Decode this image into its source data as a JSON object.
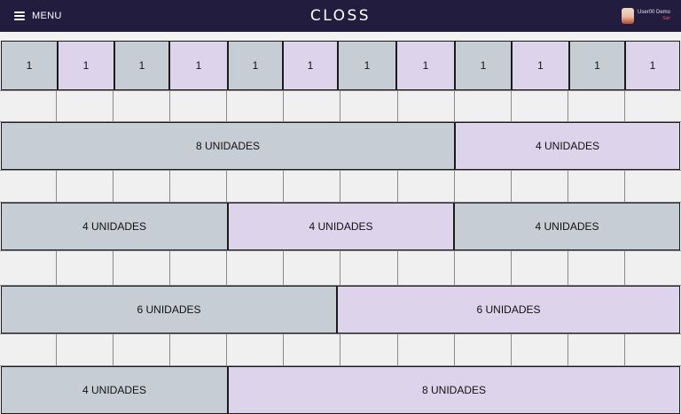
{
  "header": {
    "menu_label": "MENU",
    "logo_text": "CLOSS",
    "user_name": "User00 Demo",
    "user_role": "Sair"
  },
  "rows": {
    "r1": [
      "1",
      "1",
      "1",
      "1",
      "1",
      "1",
      "1",
      "1",
      "1",
      "1",
      "1",
      "1"
    ],
    "r2": [
      "8 UNIDADES",
      "4 UNIDADES"
    ],
    "r3": [
      "4 UNIDADES",
      "4 UNIDADES",
      "4 UNIDADES"
    ],
    "r4": [
      "6 UNIDADES",
      "6 UNIDADES"
    ],
    "r5": [
      "4 UNIDADES",
      "8 UNIDADES"
    ]
  },
  "colors": {
    "header_bg": "#221d3e",
    "gray_block": "#c7cdd4",
    "lavender_block": "#ddd3ea"
  }
}
